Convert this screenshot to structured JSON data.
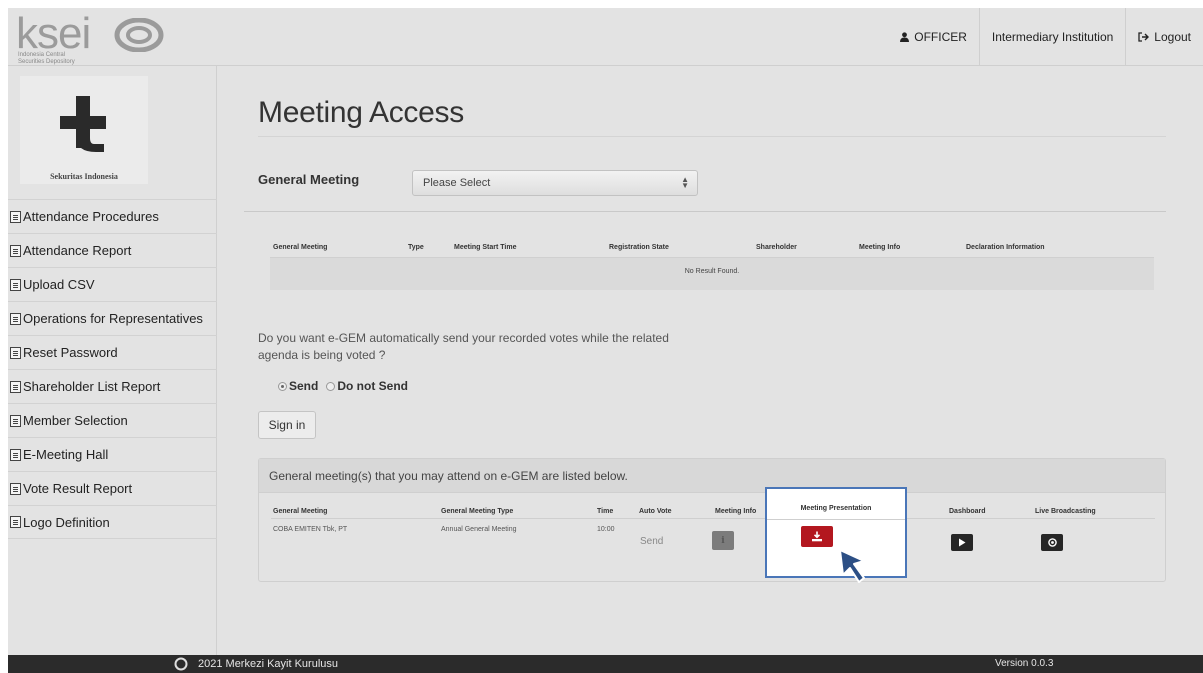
{
  "header": {
    "logo_word": "ksei",
    "logo_sub_line1": "Indonesia Central",
    "logo_sub_line2": "Securities Depository",
    "user_label": "OFFICER",
    "institution_label": "Intermediary Institution",
    "logout_label": "Logout"
  },
  "sidebar": {
    "brand_caption": "Sekuritas Indonesia",
    "items": [
      {
        "label": "Attendance Procedures"
      },
      {
        "label": "Attendance Report"
      },
      {
        "label": "Upload CSV"
      },
      {
        "label": "Operations for Representatives"
      },
      {
        "label": "Reset Password"
      },
      {
        "label": "Shareholder List Report"
      },
      {
        "label": "Member Selection"
      },
      {
        "label": "E-Meeting Hall"
      },
      {
        "label": "Vote Result Report"
      },
      {
        "label": "Logo Definition"
      }
    ]
  },
  "main": {
    "title": "Meeting Access",
    "general_meeting_label": "General Meeting",
    "select_value": "Please Select",
    "grid1": {
      "columns": [
        "General Meeting",
        "Type",
        "Meeting Start Time",
        "Registration State",
        "Shareholder",
        "Meeting Info",
        "Declaration Information"
      ],
      "empty_text": "No Result Found."
    },
    "question": "Do you want e-GEM automatically send your recorded votes while the related agenda is being voted ?",
    "radio_send": "Send",
    "radio_do_not_send": "Do not Send",
    "signin_label": "Sign in",
    "panel": {
      "heading": "General meeting(s) that you may attend on e-GEM are listed below.",
      "columns": [
        "General Meeting",
        "General Meeting Type",
        "Time",
        "Auto Vote",
        "Meeting Info",
        "Meeting Presentation",
        "Dashboard",
        "Live Broadcasting"
      ],
      "row": {
        "general_meeting": "COBA EMITEN Tbk, PT",
        "type": "Annual General Meeting",
        "time": "10:00",
        "auto_vote": "Send"
      }
    }
  },
  "footer": {
    "copyright": "2021 Merkezi Kayit Kurulusu",
    "version": "Version 0.0.3"
  }
}
